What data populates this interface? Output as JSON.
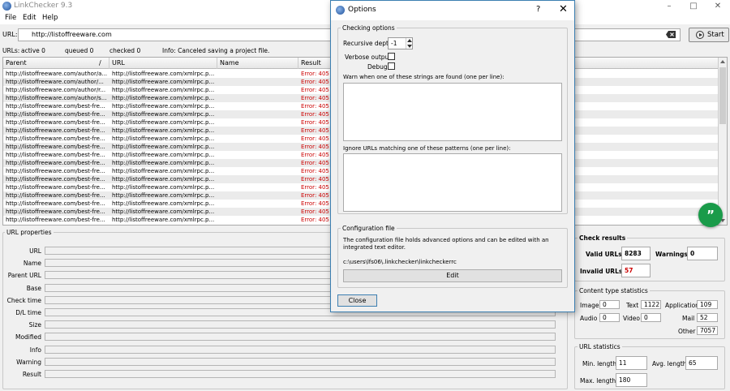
{
  "window": {
    "title": "LinkChecker 9.3"
  },
  "menu": [
    "File",
    "Edit",
    "Help"
  ],
  "url_bar": {
    "label": "URL:",
    "value": "http://listoffreeware.com",
    "start_label": "Start"
  },
  "status": {
    "urls_label": "URLs:",
    "active": "active 0",
    "queued": "queued 0",
    "checked": "checked 0",
    "info": "Info: Canceled saving a project file."
  },
  "table": {
    "columns": [
      "Parent",
      "URL",
      "Name",
      "Result"
    ],
    "rows": [
      [
        "http://listoffreeware.com/author/a...",
        "http://listoffreeware.com/xmlrpc.p...",
        "Error: 405 M"
      ],
      [
        "http://listoffreeware.com/author/...",
        "http://listoffreeware.com/xmlrpc.p...",
        "Error: 405 M"
      ],
      [
        "http://listoffreeware.com/author/r...",
        "http://listoffreeware.com/xmlrpc.p...",
        "Error: 405 M"
      ],
      [
        "http://listoffreeware.com/author/s...",
        "http://listoffreeware.com/xmlrpc.p...",
        "Error: 405 M"
      ],
      [
        "http://listoffreeware.com/best-fre...",
        "http://listoffreeware.com/xmlrpc.p...",
        "Error: 405 M"
      ],
      [
        "http://listoffreeware.com/best-fre...",
        "http://listoffreeware.com/xmlrpc.p...",
        "Error: 405 M"
      ],
      [
        "http://listoffreeware.com/best-fre...",
        "http://listoffreeware.com/xmlrpc.p...",
        "Error: 405 M"
      ],
      [
        "http://listoffreeware.com/best-fre...",
        "http://listoffreeware.com/xmlrpc.p...",
        "Error: 405 M"
      ],
      [
        "http://listoffreeware.com/best-fre...",
        "http://listoffreeware.com/xmlrpc.p...",
        "Error: 405 M"
      ],
      [
        "http://listoffreeware.com/best-fre...",
        "http://listoffreeware.com/xmlrpc.p...",
        "Error: 405 M"
      ],
      [
        "http://listoffreeware.com/best-fre...",
        "http://listoffreeware.com/xmlrpc.p...",
        "Error: 405 M"
      ],
      [
        "http://listoffreeware.com/best-fre...",
        "http://listoffreeware.com/xmlrpc.p...",
        "Error: 405 M"
      ],
      [
        "http://listoffreeware.com/best-fre...",
        "http://listoffreeware.com/xmlrpc.p...",
        "Error: 405 M"
      ],
      [
        "http://listoffreeware.com/best-fre...",
        "http://listoffreeware.com/xmlrpc.p...",
        "Error: 405 M"
      ],
      [
        "http://listoffreeware.com/best-fre...",
        "http://listoffreeware.com/xmlrpc.p...",
        "Error: 405 M"
      ],
      [
        "http://listoffreeware.com/best-fre...",
        "http://listoffreeware.com/xmlrpc.p...",
        "Error: 405 M"
      ],
      [
        "http://listoffreeware.com/best-fre...",
        "http://listoffreeware.com/xmlrpc.p...",
        "Error: 405 M"
      ],
      [
        "http://listoffreeware.com/best-fre...",
        "http://listoffreeware.com/xmlrpc.p...",
        "Error: 405 M"
      ],
      [
        "http://listoffreeware.com/best-fre...",
        "http://listoffreeware.com/xmlrpc.p...",
        "Error: 405 M"
      ]
    ]
  },
  "fab": {
    "label": "”"
  },
  "url_properties": {
    "title": "URL properties",
    "labels": [
      "URL",
      "Name",
      "Parent URL",
      "Base",
      "Check time",
      "D/L time",
      "Size",
      "Modified",
      "Info",
      "Warning",
      "Result"
    ]
  },
  "check_results": {
    "title": "Check results",
    "valid_label": "Valid URLs",
    "valid": "8283",
    "warnings_label": "Warnings",
    "warnings": "0",
    "invalid_label": "Invalid URLs",
    "invalid": "57"
  },
  "content_stats": {
    "title": "Content type statistics",
    "image_label": "Image",
    "image": "0",
    "text_label": "Text",
    "text": "1122",
    "application_label": "Application",
    "application": "109",
    "audio_label": "Audio",
    "audio": "0",
    "video_label": "Video",
    "video": "0",
    "mail_label": "Mail",
    "mail": "52",
    "other_label": "Other",
    "other": "7057"
  },
  "url_stats": {
    "title": "URL statistics",
    "min_label": "Min. length",
    "min": "11",
    "avg_label": "Avg. length",
    "avg": "65",
    "max_label": "Max. length",
    "max": "180"
  },
  "options": {
    "title": "Options",
    "help": "?",
    "close_x": "✕",
    "checking_title": "Checking options",
    "depth_label": "Recursive depth",
    "depth_value": "-1",
    "verbose_label": "Verbose output",
    "debug_label": "Debug",
    "warn_label": "Warn when one of these strings are found (one per line):",
    "ignore_label": "Ignore URLs matching one of these patterns (one per line):",
    "config_title": "Configuration file",
    "config_text": "The configuration file holds advanced options and can be edited with an integrated text editor.",
    "config_path": "c:\\users\\lfs06\\.linkchecker\\linkcheckerrc",
    "edit_label": "Edit",
    "close_label": "Close"
  },
  "colors": {
    "error": "#cc0000",
    "fab": "#1a9b4a",
    "dialog_border": "#3c7fb1"
  }
}
